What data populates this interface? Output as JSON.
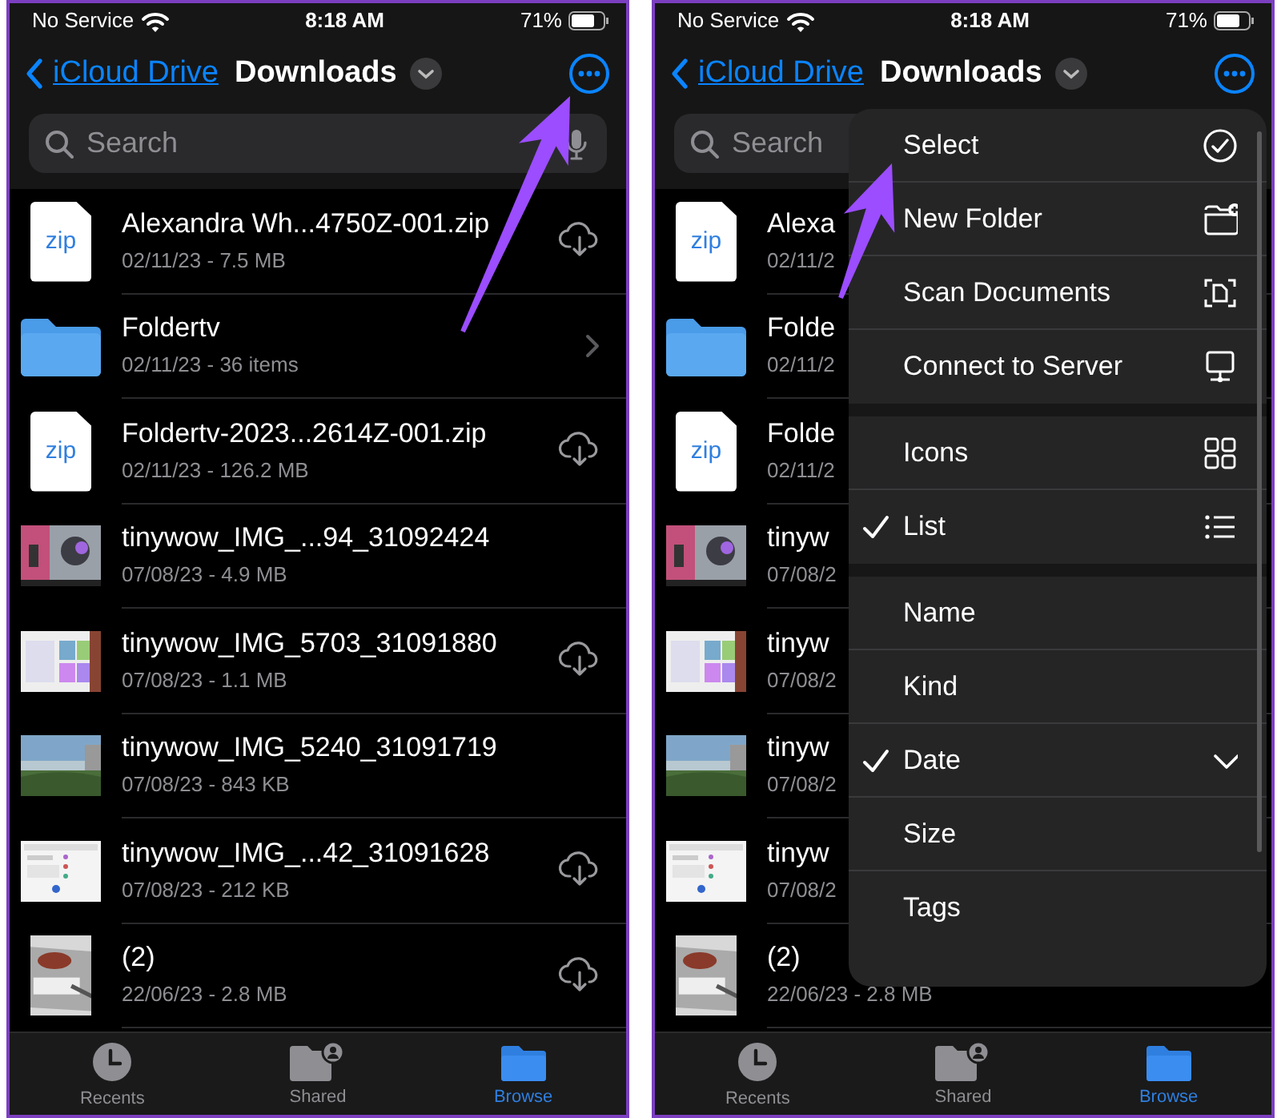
{
  "panels": [
    {
      "status_bar": {
        "carrier": "No Service",
        "time": "8:18 AM",
        "battery": "71%"
      },
      "nav": {
        "back": "iCloud Drive",
        "title": "Downloads"
      },
      "search": {
        "placeholder": "Search"
      },
      "files": [
        {
          "kind": "zip",
          "thumb_label": "zip",
          "name": "Alexandra Wh...4750Z-001.zip",
          "meta": "02/11/23 - 7.5 MB",
          "downloaded": false
        },
        {
          "kind": "folder",
          "name": "Foldertv",
          "meta": "02/11/23 - 36 items",
          "disclosure": true
        },
        {
          "kind": "zip",
          "thumb_label": "zip",
          "name": "Foldertv-2023...2614Z-001.zip",
          "meta": "02/11/23 - 126.2 MB",
          "downloaded": false
        },
        {
          "name": "tinywow_IMG_...94_31092424",
          "meta": "07/08/23 - 4.9 MB",
          "downloaded": true
        },
        {
          "name": "tinywow_IMG_5703_31091880",
          "meta": "07/08/23 - 1.1 MB",
          "downloaded": false
        },
        {
          "name": "tinywow_IMG_5240_31091719",
          "meta": "07/08/23 - 843 KB",
          "downloaded": true
        },
        {
          "name": "tinywow_IMG_...42_31091628",
          "meta": "07/08/23 - 212 KB",
          "downloaded": false
        },
        {
          "name": "(2)",
          "meta": "22/06/23 - 2.8 MB",
          "downloaded": false
        }
      ],
      "tabs": [
        {
          "label": "Recents",
          "selected": false
        },
        {
          "label": "Shared",
          "selected": false
        },
        {
          "label": "Browse",
          "selected": true
        }
      ],
      "annotation_arrow": true
    },
    {
      "status_bar": {
        "carrier": "No Service",
        "time": "8:18 AM",
        "battery": "71%"
      },
      "nav": {
        "back": "iCloud Drive",
        "title": "Downloads"
      },
      "search": {
        "placeholder": "Search"
      },
      "files": [
        {
          "kind": "zip",
          "thumb_label": "zip",
          "name": "Alexa",
          "meta": "02/11/2"
        },
        {
          "kind": "folder",
          "name": "Folde",
          "meta": "02/11/2"
        },
        {
          "kind": "zip",
          "thumb_label": "zip",
          "name": "Folde",
          "meta": "02/11/2"
        },
        {
          "name": "tinyw",
          "meta": "07/08/2"
        },
        {
          "name": "tinyw",
          "meta": "07/08/2"
        },
        {
          "name": "tinyw",
          "meta": "07/08/2"
        },
        {
          "name": "tinyw",
          "meta": "07/08/2"
        },
        {
          "name": "(2)",
          "meta": "22/06/23 - 2.8 MB"
        }
      ],
      "tabs": [
        {
          "label": "Recents",
          "selected": false
        },
        {
          "label": "Shared",
          "selected": false
        },
        {
          "label": "Browse",
          "selected": true
        }
      ],
      "menu": {
        "sections": [
          {
            "items": [
              {
                "label": "Select",
                "checked": false
              },
              {
                "label": "New Folder",
                "checked": false
              },
              {
                "label": "Scan Documents",
                "checked": false
              },
              {
                "label": "Connect to Server",
                "checked": false
              }
            ]
          },
          {
            "items": [
              {
                "label": "Icons",
                "checked": false
              },
              {
                "label": "List",
                "checked": true
              }
            ]
          },
          {
            "items": [
              {
                "label": "Name",
                "checked": false,
                "descending": false
              },
              {
                "label": "Kind",
                "checked": false,
                "descending": false
              },
              {
                "label": "Date",
                "checked": true,
                "descending": true
              },
              {
                "label": "Size",
                "checked": false,
                "descending": false
              },
              {
                "label": "Tags",
                "checked": false,
                "descending": false
              }
            ]
          }
        ]
      },
      "annotation_arrow": true
    }
  ]
}
